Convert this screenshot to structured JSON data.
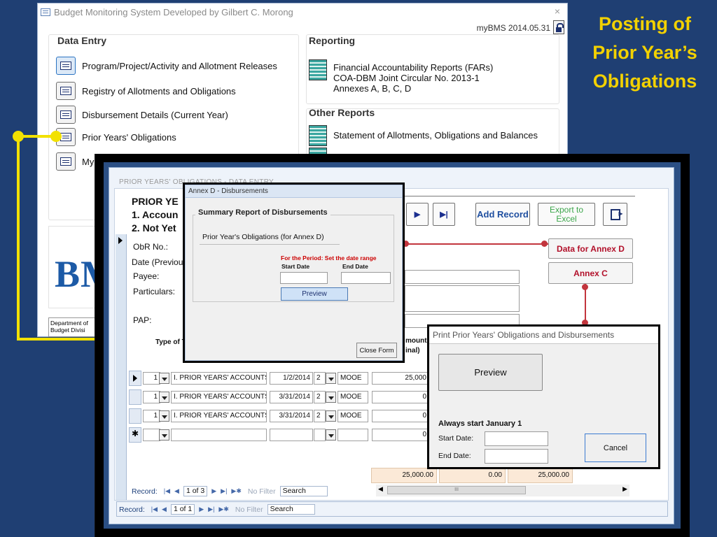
{
  "slide_title": [
    "Posting of",
    "Prior Year’s",
    "Obligations"
  ],
  "main_window": {
    "title": "Budget Monitoring System Developed by Gilbert C. Morong",
    "close": "×",
    "version": "myBMS 2014.05.31",
    "data_entry": {
      "heading": "Data Entry",
      "items": [
        "Program/Project/Activity and Allotment Releases",
        "Registry of Allotments and Obligations",
        "Disbursement Details (Current Year)",
        "Prior Years' Obligations",
        "My"
      ]
    },
    "reporting": {
      "heading": "Reporting",
      "far_lines": [
        "Financial Accountability Reports (FARs)",
        "COA-DBM Joint Circular No. 2013-1",
        "Annexes A, B, C, D"
      ]
    },
    "other_reports": {
      "heading": "Other Reports",
      "item": "Statement of Allotments, Obligations and Balances"
    },
    "logo": "BM",
    "dept_lines": [
      "Department of",
      "Budget Divisi"
    ]
  },
  "form": {
    "tab_label": "PRIOR YEARS' OBLIGATIONS - DATA ENTRY",
    "heading_lines": [
      "PRIOR YE",
      "1. Accoun",
      "2. Not Yet"
    ],
    "labels": {
      "obr": "ObR No.:",
      "date": "Date (Previou",
      "payee": "Payee:",
      "particulars": "Particulars:",
      "pap": "PAP:",
      "type": "Type of T",
      "amount": "mount",
      "amount2": "inal)"
    },
    "buttons": {
      "next": "▶",
      "last": "▶|",
      "add_record": "Add Record",
      "export": "Export to Excel",
      "data_annex_d": "Data for Annex D",
      "annex_c": "Annex C"
    },
    "rows": [
      {
        "no": "1",
        "account": "I. PRIOR YEARS' ACCOUNTS P",
        "date": "1/2/2014",
        "code": "2",
        "class": "MOOE",
        "amount": "25,000"
      },
      {
        "no": "1",
        "account": "I. PRIOR YEARS' ACCOUNTS P",
        "date": "3/31/2014",
        "code": "2",
        "class": "MOOE",
        "amount": "0"
      },
      {
        "no": "1",
        "account": "I. PRIOR YEARS' ACCOUNTS P",
        "date": "3/31/2014",
        "code": "2",
        "class": "MOOE",
        "amount": "0"
      }
    ],
    "new_row_amount": "0",
    "totals": [
      "25,000.00",
      "0.00",
      "25,000.00"
    ],
    "sub_record_bar": {
      "label": "Record:",
      "position": "1 of 3",
      "filter": "No Filter",
      "search": "Search"
    },
    "main_record_bar": {
      "label": "Record:",
      "position": "1 of 1",
      "filter": "No Filter",
      "search": "Search"
    },
    "scroll_thumb": "III"
  },
  "annex_d_dialog": {
    "title": "Annex D - Disbursements",
    "group_title": "Summary Report of Disbursements",
    "subtitle": "Prior Year's Obligations (for Annex D)",
    "period_note": "For the Period:  Set the date range",
    "start_label": "Start Date",
    "end_label": "End Date",
    "preview": "Preview",
    "close": "Close Form"
  },
  "print_dialog": {
    "title": "Print Prior Years' Obligations and Disbursements",
    "preview": "Preview",
    "note": "Always start January 1",
    "start_label": "Start Date:",
    "end_label": "End Date:",
    "cancel": "Cancel"
  },
  "colors": {
    "background": "#1f3f73",
    "title_yellow": "#f2d100",
    "connector_yellow": "#f2e100",
    "red_accent": "#c2353d"
  }
}
